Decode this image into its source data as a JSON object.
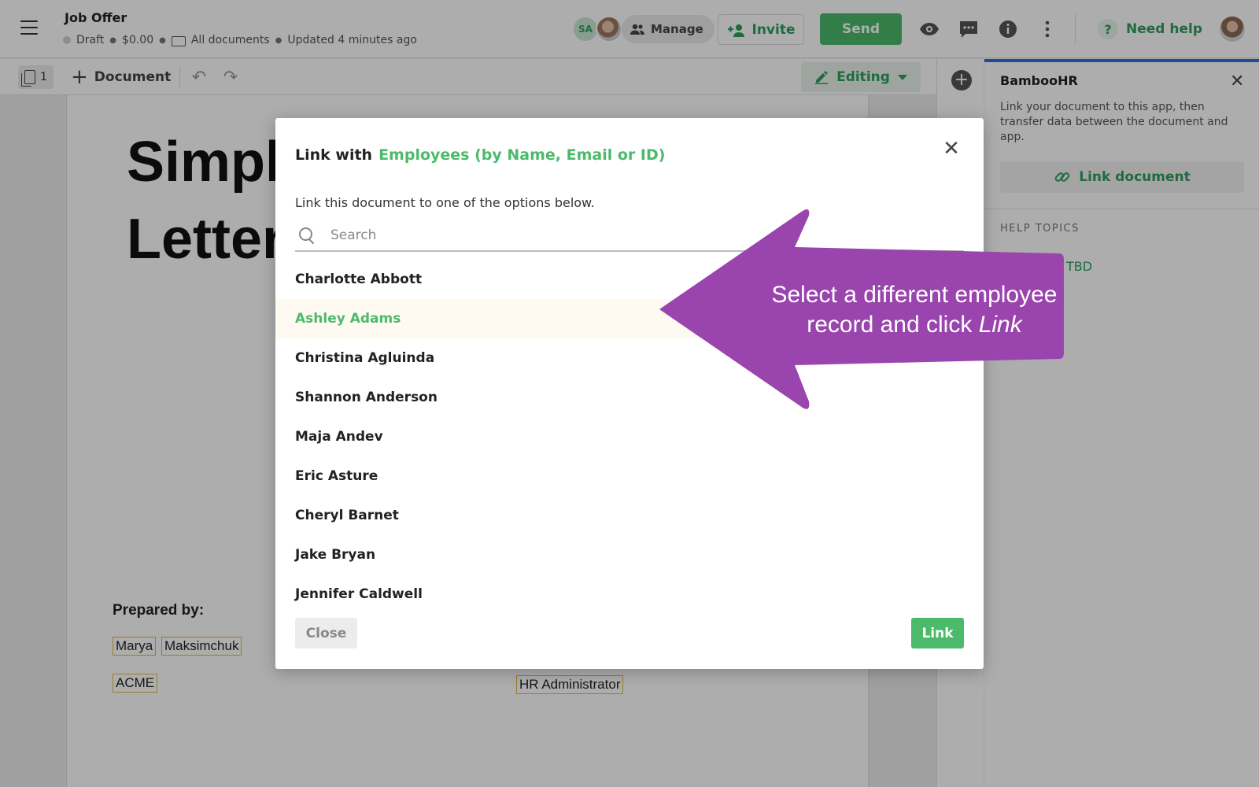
{
  "header": {
    "doc_title": "Job Offer",
    "status": "Draft",
    "amount": "$0.00",
    "folder": "All documents",
    "updated": "Updated 4 minutes ago",
    "avatar_initials": "SA",
    "manage_label": "Manage",
    "invite_label": "Invite",
    "send_label": "Send",
    "help_label": "Need help"
  },
  "toolbar": {
    "page_count": "1",
    "add_document_label": "Document",
    "editing_label": "Editing"
  },
  "document": {
    "title_partial": "Simpl\nLetter",
    "prepared_by_label": "Prepared by:",
    "fields": {
      "first_name": "Marya",
      "last_name": "Maksimchuk",
      "company": "ACME",
      "job_title": "HR Administrator"
    }
  },
  "side_panel": {
    "title": "BambooHR",
    "description": "Link your document to this app, then transfer data between the document and app.",
    "link_button_label": "Link document",
    "help_topics_heading": "HELP TOPICS",
    "help_topic": "TBD"
  },
  "modal": {
    "title_prefix": "Link with",
    "title_target": "Employees (by Name, Email or ID)",
    "subtitle": "Link this document to one of the options below.",
    "search_placeholder": "Search",
    "employees": [
      "Charlotte Abbott",
      "Ashley Adams",
      "Christina Agluinda",
      "Shannon Anderson",
      "Maja Andev",
      "Eric Asture",
      "Cheryl Barnet",
      "Jake Bryan",
      "Jennifer Caldwell"
    ],
    "selected_employee": "Ashley Adams",
    "close_label": "Close",
    "link_label": "Link"
  },
  "callout": {
    "line1": "Select a different employee",
    "line2_prefix": "record and click",
    "line2_emphasis": "Link"
  },
  "colors": {
    "accent_green": "#4cba6b",
    "callout_purple": "#9a44ad",
    "panel_top_border": "#2f6fd6"
  },
  "icons": [
    "menu-icon",
    "folder-icon",
    "people-icon",
    "add-user-icon",
    "eye-icon",
    "comment-icon",
    "info-icon",
    "more-vertical-icon",
    "question-icon",
    "pages-icon",
    "plus-icon",
    "undo-icon",
    "redo-icon",
    "pencil-icon",
    "close-icon",
    "link-icon",
    "search-icon"
  ]
}
